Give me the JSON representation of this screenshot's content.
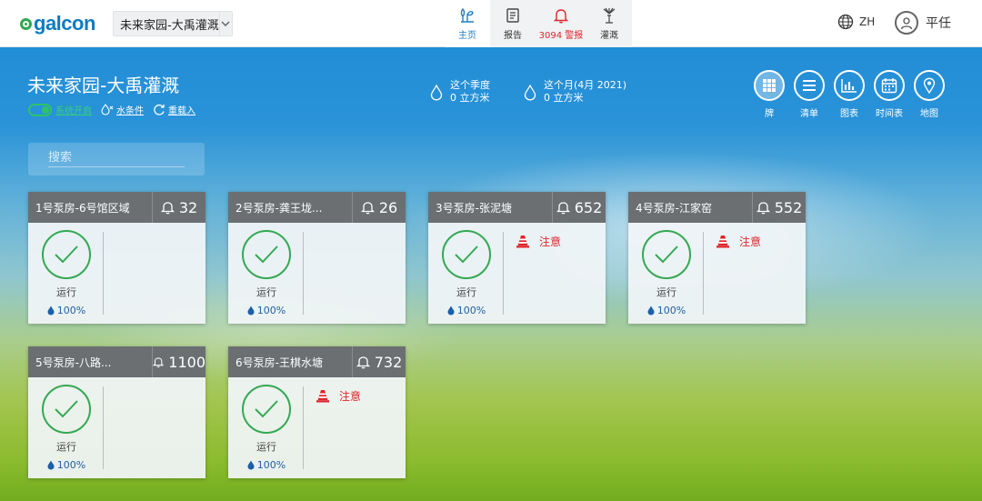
{
  "brand": {
    "logo_text": "galcon"
  },
  "site_selector": {
    "value": "未来家园-大禹灌溉"
  },
  "nav": [
    {
      "label": "主页",
      "icon": "home-plant-icon"
    },
    {
      "label": "报告",
      "icon": "report-icon"
    },
    {
      "label": "3094 警报",
      "icon": "bell-icon"
    },
    {
      "label": "灌溉",
      "icon": "sprinkler-icon"
    }
  ],
  "lang": {
    "label": "ZH"
  },
  "user": {
    "name": "平任"
  },
  "header": {
    "title": "未来家园-大禹灌溉",
    "system_label": "系统开启",
    "water_label": "水条件",
    "reload_label": "重载入",
    "stats": [
      {
        "title": "这个季度",
        "value": "0 立方米"
      },
      {
        "title": "这个月(4月 2021)",
        "value": "0 立方米"
      }
    ]
  },
  "views": [
    {
      "label": "牌",
      "icon": "grid-icon"
    },
    {
      "label": "清单",
      "icon": "list-icon"
    },
    {
      "label": "图表",
      "icon": "chart-icon"
    },
    {
      "label": "时间表",
      "icon": "calendar-icon"
    },
    {
      "label": "地图",
      "icon": "map-pin-icon"
    }
  ],
  "search": {
    "placeholder": "搜索"
  },
  "colors": {
    "accent": "#1f7fc4",
    "ok_green": "#34a853",
    "alarm_red": "#e0252b",
    "card_header": "#6b6f72"
  },
  "cards": [
    {
      "name": "1号泵房-6号馆区域",
      "alarms": "32",
      "status": "运行",
      "percent": "100%",
      "warning": ""
    },
    {
      "name": "2号泵房-龚王垅...",
      "alarms": "26",
      "status": "运行",
      "percent": "100%",
      "warning": ""
    },
    {
      "name": "3号泵房-张泥塘",
      "alarms": "652",
      "status": "运行",
      "percent": "100%",
      "warning": "注意"
    },
    {
      "name": "4号泵房-江家窑",
      "alarms": "552",
      "status": "运行",
      "percent": "100%",
      "warning": "注意"
    },
    {
      "name": "5号泵房-八路...",
      "alarms": "1100",
      "status": "运行",
      "percent": "100%",
      "warning": ""
    },
    {
      "name": "6号泵房-王棋水塘",
      "alarms": "732",
      "status": "运行",
      "percent": "100%",
      "warning": "注意"
    }
  ]
}
